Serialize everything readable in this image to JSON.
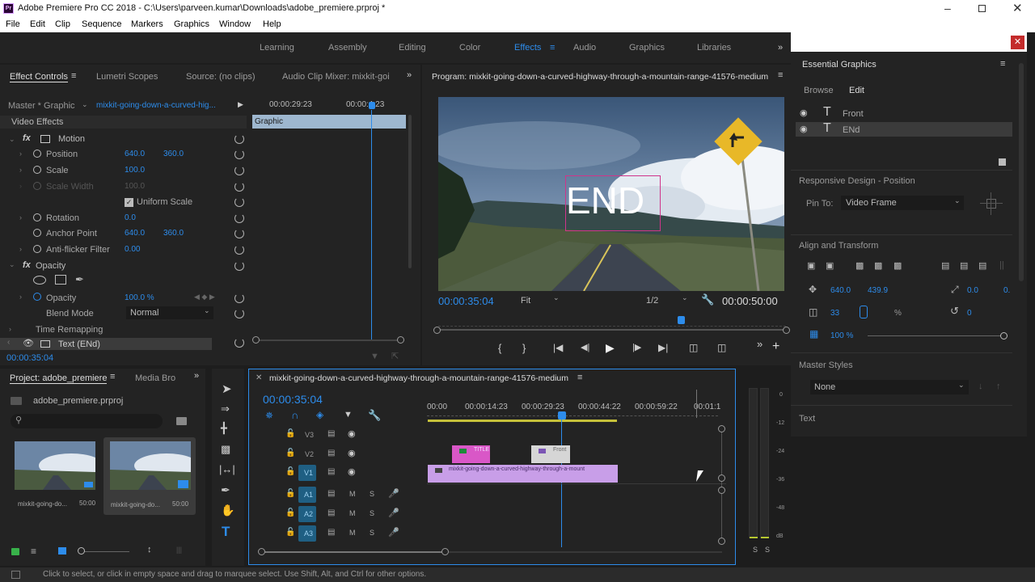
{
  "app": {
    "title": "Adobe Premiere Pro CC 2018 - C:\\Users\\parveen.kumar\\Downloads\\adobe_premiere.prproj *",
    "icon_label": "Pr"
  },
  "menu": [
    "File",
    "Edit",
    "Clip",
    "Sequence",
    "Markers",
    "Graphics",
    "Window",
    "Help"
  ],
  "workspaces": {
    "learning": "Learning",
    "assembly": "Assembly",
    "editing": "Editing",
    "color": "Color",
    "effects": "Effects",
    "audio": "Audio",
    "graphics": "Graphics",
    "libraries": "Libraries"
  },
  "effect_controls": {
    "tab_effect_controls": "Effect Controls",
    "tab_lumetri": "Lumetri Scopes",
    "tab_source": "Source: (no clips)",
    "tab_audio_mixer": "Audio Clip Mixer: mixkit-goi",
    "master": "Master * Graphic",
    "clip": "mixkit-going-down-a-curved-hig...",
    "time_start": "00:00:29:23",
    "time_end": "00:00:4:23",
    "graphic_bar": "Graphic",
    "video_effects": "Video Effects",
    "motion": "Motion",
    "position": "Position",
    "pos_x": "640.0",
    "pos_y": "360.0",
    "scale": "Scale",
    "scale_val": "100.0",
    "scale_width": "Scale Width",
    "scale_width_val": "100.0",
    "uniform_scale": "Uniform Scale",
    "rotation": "Rotation",
    "rotation_val": "0.0",
    "anchor": "Anchor Point",
    "anchor_x": "640.0",
    "anchor_y": "360.0",
    "antiflicker": "Anti-flicker Filter",
    "antiflicker_val": "0.00",
    "opacity_group": "Opacity",
    "opacity": "Opacity",
    "opacity_val": "100.0 %",
    "blend": "Blend Mode",
    "blend_val": "Normal",
    "time_remap": "Time Remapping",
    "text_layer": "Text (ENd)",
    "current_time": "00:00:35:04"
  },
  "program": {
    "title": "Program: mixkit-going-down-a-curved-highway-through-a-mountain-range-41576-medium",
    "overlay_text": "END",
    "timecode": "00:00:35:04",
    "fit": "Fit",
    "resolution": "1/2",
    "duration": "00:00:50:00"
  },
  "project": {
    "tab_project": "Project: adobe_premiere",
    "tab_media": "Media Bro",
    "file": "adobe_premiere.prproj",
    "clip1_name": "mixkit-going-do...",
    "clip1_dur": "50:00",
    "clip2_name": "mixkit-going-do...",
    "clip2_dur": "50:00"
  },
  "timeline": {
    "title": "mixkit-going-down-a-curved-highway-through-a-mountain-range-41576-medium",
    "timecode": "00:00:35:04",
    "ruler": [
      "00:00",
      "00:00:14:23",
      "00:00:29:23",
      "00:00:44:22",
      "00:00:59:22",
      "00:01:1"
    ],
    "tracks": [
      "V3",
      "V2",
      "V1",
      "A1",
      "A2",
      "A3"
    ],
    "m": "M",
    "s": "S",
    "clip_title": "TITLE",
    "clip_front": "Front",
    "clip_main": "mixkit-going-down-a-curved-highway-through-a-mount"
  },
  "meters": {
    "scale": [
      "0",
      "-12",
      "-24",
      "-36",
      "-48",
      "dB"
    ],
    "solo": "S"
  },
  "essential": {
    "title": "Essential Graphics",
    "tab_browse": "Browse",
    "tab_edit": "Edit",
    "layer_front": "Front",
    "layer_end": "ENd",
    "responsive": "Responsive Design - Position",
    "pin_to": "Pin To:",
    "pin_val": "Video Frame",
    "align": "Align and Transform",
    "x": "640.0",
    "y": "439.9",
    "rot": "0.0",
    "rot2": "0.",
    "scale": "33",
    "pct": "%",
    "angle": "0",
    "opacity": "100 %",
    "master_styles": "Master Styles",
    "none": "None",
    "text": "Text"
  },
  "status": "Click to select, or click in empty space and drag to marquee select. Use Shift, Alt, and Ctrl for other options.",
  "colors": {
    "accent": "#2d8ceb",
    "pink_clip": "#d957c7",
    "lavender_clip": "#c89ee8",
    "bg": "#1d1d1d"
  }
}
